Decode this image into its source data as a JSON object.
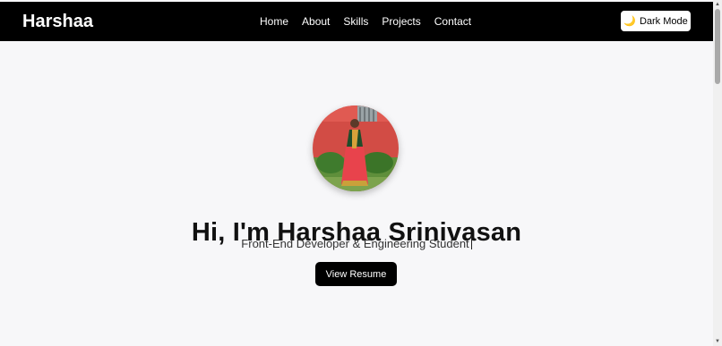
{
  "navbar": {
    "brand": "Harshaa",
    "links": [
      {
        "label": "Home"
      },
      {
        "label": "About"
      },
      {
        "label": "Skills"
      },
      {
        "label": "Projects"
      },
      {
        "label": "Contact"
      }
    ],
    "theme_toggle": {
      "icon": "moon-icon",
      "label": "Dark Mode"
    }
  },
  "hero": {
    "headline": "Hi, I'm Harshaa Srinivasan",
    "subtitle": "Front-End Developer & Engineering Student",
    "resume_button": "View Resume"
  },
  "colors": {
    "navbar_bg": "#000000",
    "page_bg": "#f7f7f9",
    "button_bg": "#000000",
    "button_text": "#ffffff"
  }
}
